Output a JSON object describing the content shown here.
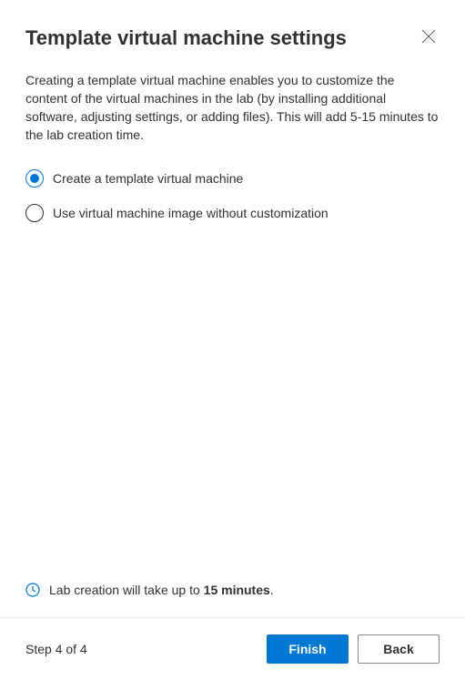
{
  "header": {
    "title": "Template virtual machine settings"
  },
  "description": "Creating a template virtual machine enables you to customize the content of the virtual machines in the lab (by installing additional software, adjusting settings, or adding files). This will add 5-15 minutes to the lab creation time.",
  "radio_options": {
    "opt1": "Create a template virtual machine",
    "opt2": "Use virtual machine image without customization",
    "selected": "opt1"
  },
  "info": {
    "prefix": "Lab creation will take up to ",
    "bold": "15 minutes",
    "suffix": "."
  },
  "footer": {
    "step_label": "Step 4 of 4",
    "finish": "Finish",
    "back": "Back"
  },
  "colors": {
    "accent": "#0078d4"
  }
}
